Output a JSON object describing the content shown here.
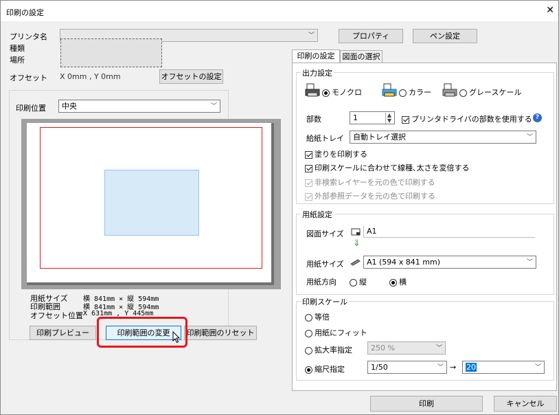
{
  "window": {
    "title": "印刷の設定",
    "close_glyph": "✕"
  },
  "printer": {
    "name_label": "プリンタ名",
    "type_label": "種類",
    "location_label": "場所",
    "offset_label": "オフセット",
    "offset_value": "X 0mm , Y 0mm",
    "offset_button": "オフセットの設定",
    "properties_button": "プロパティ",
    "pen_button": "ペン設定"
  },
  "print_position": {
    "label": "印刷位置",
    "value": "中央"
  },
  "preview_info": [
    {
      "label": "用紙サイズ",
      "value": "横 841mm × 縦 594mm"
    },
    {
      "label": "印刷範囲",
      "value": "横 841mm × 縦 594mm"
    },
    {
      "label": "オフセット位置",
      "value": "X 631mm , Y 445mm"
    }
  ],
  "preview_buttons": {
    "preview": "印刷プレビュー",
    "change_range": "印刷範囲の変更",
    "reset_range": "印刷範囲のリセット"
  },
  "tabs": [
    {
      "label": "印刷の設定"
    },
    {
      "label": "図面の選択"
    }
  ],
  "output": {
    "group_label": "出力設定",
    "mono": "モノクロ",
    "color": "カラー",
    "gray": "グレースケール",
    "copies_label": "部数",
    "copies_value": "1",
    "use_driver_copies": "プリンタドライバの部数を使用する",
    "tray_label": "給紙トレイ",
    "tray_value": "自動トレイ選択",
    "fill_print": "塗りを印刷する",
    "scale_linewidth": "印刷スケールに合わせて線種､太さを変倍する",
    "non_search_layer": "非検索レイヤーを元の色で印刷する",
    "external_ref": "外部参照データを元の色で印刷する"
  },
  "paper": {
    "group_label": "用紙設定",
    "drawing_size_label": "図面サイズ",
    "drawing_size_value": "A1",
    "paper_size_label": "用紙サイズ",
    "paper_size_value": "A1 (594 x 841 mm)",
    "orientation_label": "用紙方向",
    "portrait": "縦",
    "landscape": "横"
  },
  "scale": {
    "group_label": "印刷スケール",
    "actual": "等倍",
    "fit": "用紙にフィット",
    "zoom": "拡大率指定",
    "zoom_value": "250 %",
    "reduce": "縮尺指定",
    "reduce_value": "1/50",
    "arrow": "→",
    "target_value": "20"
  },
  "footer": {
    "print": "印刷",
    "cancel": "キャンセル"
  },
  "colors": {
    "highlight": "#e8141b",
    "selection_blue": "#0078d7",
    "print_area": "#d7eaf8"
  }
}
